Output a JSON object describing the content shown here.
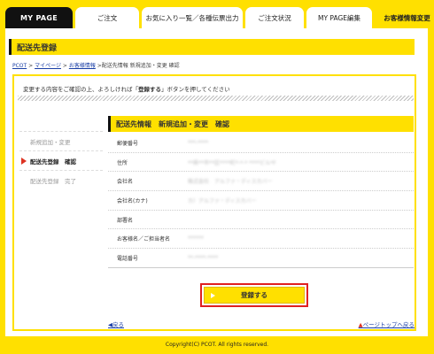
{
  "nav": {
    "tabs": [
      {
        "label": "MY PAGE"
      },
      {
        "label": "ご注文"
      },
      {
        "label": "お気に入り一覧／各種伝票出力"
      },
      {
        "label": "ご注文状況"
      },
      {
        "label": "MY PAGE編集"
      },
      {
        "label": "お客様情報変更"
      }
    ]
  },
  "page": {
    "title": "配送先登録"
  },
  "breadcrumb": {
    "items": [
      "PCOT",
      "マイページ",
      "お客様情報"
    ],
    "separator": ">",
    "current": ">配送先情報 新規追加・変更 確認"
  },
  "notice": {
    "before": "変更する内容をご確認の上、よろしければ「",
    "bold": "登録する",
    "after": "」ボタンを押してください"
  },
  "steps": [
    {
      "label": "新規追加・変更",
      "state": "done"
    },
    {
      "label": "配送先登録　確認",
      "state": "current"
    },
    {
      "label": "配送先登録　完了",
      "state": "todo"
    }
  ],
  "section": {
    "title": "配送先情報　新規追加・変更　確認"
  },
  "form_rows": [
    {
      "label": "郵便番号",
      "value": "***-****"
    },
    {
      "label": "住所",
      "value": "**県**市**区****町*-*-* ****ビル*F"
    },
    {
      "label": "会社名",
      "value": "株式会社　アルファ・ディスカバー"
    },
    {
      "label": "会社名(カナ)",
      "value": "カ）アルファ・ディスカバー"
    },
    {
      "label": "部署名",
      "value": ""
    },
    {
      "label": "お客様名／ご担当者名",
      "value": "******"
    },
    {
      "label": "電話番号",
      "value": "**-****-****"
    }
  ],
  "actions": {
    "submit_label": "登録する",
    "back_label": "◀戻る",
    "pagetop_arrow": "▲",
    "pagetop_label": "ページトップへ戻る"
  },
  "footer": {
    "copyright": "Copyright(C) PCOT. All rights reserved."
  },
  "colors": {
    "brand_yellow": "#FFE000",
    "nav_dark": "#111111",
    "highlight_red": "#E02020",
    "link_blue": "#1A3FA6"
  }
}
